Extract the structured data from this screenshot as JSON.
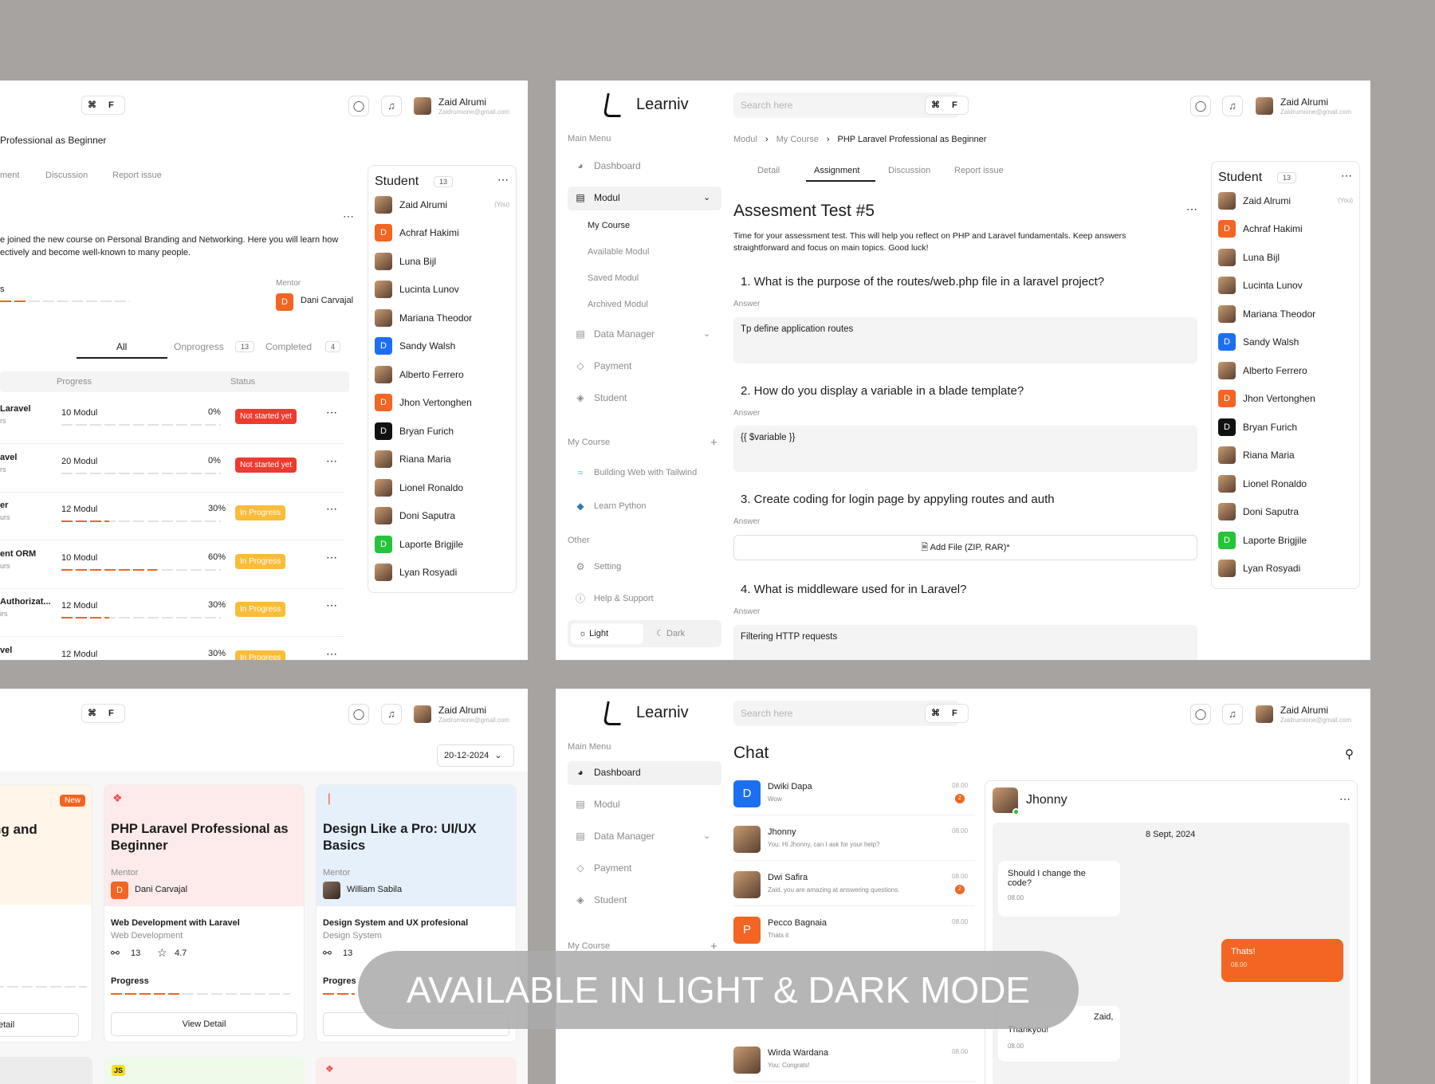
{
  "brand": {
    "name": "Learniv"
  },
  "search": {
    "placeholder": "Search here",
    "shortcut": "⌘ F"
  },
  "user": {
    "name": "Zaid Alrumi",
    "email": "Zaidrumione@gmail.com"
  },
  "students": {
    "title": "Student",
    "count": "13",
    "you_label": "(You)",
    "list": [
      {
        "name": "Zaid Alrumi",
        "avatar": "photo"
      },
      {
        "name": "Achraf Hakimi",
        "avatar": "D",
        "color": "#f26522"
      },
      {
        "name": "Luna Bijl",
        "avatar": "photo"
      },
      {
        "name": "Lucinta Lunov",
        "avatar": "photo"
      },
      {
        "name": "Mariana Theodor",
        "avatar": "photo"
      },
      {
        "name": "Sandy Walsh",
        "avatar": "D",
        "color": "#1d6ff2"
      },
      {
        "name": "Alberto Ferrero",
        "avatar": "photo"
      },
      {
        "name": "Jhon Vertonghen",
        "avatar": "D",
        "color": "#f26522"
      },
      {
        "name": "Bryan Furich",
        "avatar": "D",
        "color": "#111111"
      },
      {
        "name": "Riana Maria",
        "avatar": "photo"
      },
      {
        "name": "Lionel Ronaldo",
        "avatar": "photo"
      },
      {
        "name": "Doni Saputra",
        "avatar": "photo"
      },
      {
        "name": "Laporte Brigjile",
        "avatar": "D",
        "color": "#25c43a"
      },
      {
        "name": "Lyan Rosyadi",
        "avatar": "photo"
      }
    ]
  },
  "panel1": {
    "course_title": "Professional as Beginner",
    "tabs": [
      "ment",
      "Discussion",
      "Report issue"
    ],
    "intro": "e joined the new course on Personal Branding and Networking. Here you will learn how",
    "intro2": "ectively and become well-known to many people.",
    "stub": "s",
    "mentor_label": "Mentor",
    "mentor_name": "Dani Carvajal",
    "filters": {
      "all": "All",
      "onprogress": "Onprogress",
      "onprogress_count": "13",
      "completed": "Completed",
      "completed_count": "4"
    },
    "headers": {
      "progress": "Progress",
      "status": "Status"
    },
    "rows": [
      {
        "title": "Laravel",
        "sub": "rs",
        "modules": "10 Modul",
        "percent": "0%",
        "status": "Not started yet",
        "kind": "red",
        "fill": 0
      },
      {
        "title": "avel",
        "sub": "rs",
        "modules": "20 Modul",
        "percent": "0%",
        "status": "Not started yet",
        "kind": "red",
        "fill": 0
      },
      {
        "title": "er",
        "sub": "urs",
        "modules": "12 Modul",
        "percent": "30%",
        "status": "In Progress",
        "kind": "yellow",
        "fill": 0.3
      },
      {
        "title": "ent ORM",
        "sub": "urs",
        "modules": "10 Modul",
        "percent": "60%",
        "status": "In Progress",
        "kind": "yellow",
        "fill": 0.6
      },
      {
        "title": "Authorizat...",
        "sub": "irs",
        "modules": "12 Modul",
        "percent": "30%",
        "status": "In Progress",
        "kind": "yellow",
        "fill": 0.3
      },
      {
        "title": "vel",
        "sub": "",
        "modules": "12 Modul",
        "percent": "30%",
        "status": "In Progress",
        "kind": "yellow",
        "fill": 0.3
      }
    ]
  },
  "sidebar": {
    "main_menu": "Main Menu",
    "dashboard": "Dashboard",
    "modul": "Modul",
    "sub": [
      "My Course",
      "Available Modul",
      "Saved Modul",
      "Archived Modul"
    ],
    "data_manager": "Data Manager",
    "payment": "Payment",
    "student": "Student",
    "my_course": "My Course",
    "courses": [
      "Building Web with Tailwind",
      "Learn Python"
    ],
    "other": "Other",
    "setting": "Setting",
    "help": "Help & Support",
    "light": "Light",
    "dark": "Dark"
  },
  "panel2": {
    "breadcrumb": [
      "Modul",
      "My Course",
      "PHP Laravel Professional as Beginner"
    ],
    "tabs": [
      "Detail",
      "Assignment",
      "Discussion",
      "Report issue"
    ],
    "title": "Assesment Test #5",
    "desc1": "Time for your assessment test. This will help you reflect on PHP and Laravel fundamentals. Keep answers",
    "desc2": "straightforward and focus on main topics. Good luck!",
    "answer_label": "Answer",
    "questions": [
      {
        "q": "1. What is the purpose  of the routes/web.php file in a laravel project?",
        "a": "Tp define application routes"
      },
      {
        "q": "2. How do you display a variable in a blade template?",
        "a": "{{ $variable }}"
      },
      {
        "q": "3. Create coding for login page by appyling routes and auth",
        "a": "Add File (ZIP, RAR)*"
      },
      {
        "q": "4. What is middleware used for in Laravel?",
        "a": "Filtering HTTP requests"
      }
    ]
  },
  "panel3": {
    "date": "20-12-2024",
    "stub_title": "ng and",
    "new_badge": "New",
    "stub_btn": "etail",
    "cards": [
      {
        "title": "PHP Laravel Professional as Beginner",
        "mentor_label": "Mentor",
        "mentor": "Dani Carvajal",
        "course": "Web Development with Laravel",
        "category": "Web Development",
        "students": "13",
        "rating": "4.7",
        "progress_label": "Progress",
        "button": "View Detail"
      },
      {
        "title": "Design Like a Pro: UI/UX Basics",
        "mentor_label": "Mentor",
        "mentor": "William Sabila",
        "course": "Design System and UX profesional",
        "category": "Design System",
        "students": "13",
        "progress_label": "Progres"
      }
    ],
    "bottom_tag": "JS"
  },
  "panel4": {
    "title": "Chat",
    "chats": [
      {
        "name": "Dwiki Dapa",
        "msg": "Wow",
        "time": "08.00",
        "unread": "2",
        "avatar": "D",
        "color": "#1d6ff2"
      },
      {
        "name": "Jhonny",
        "msg": "You: Hi Jhonny, can I ask for your help?",
        "time": "08.00",
        "avatar": "photo"
      },
      {
        "name": "Dwi Safira",
        "msg": "Zaid, you are amazing at answering questions.",
        "time": "08.00",
        "unread": "2",
        "avatar": "photo"
      },
      {
        "name": "Pecco Bagnaia",
        "msg": "Thats it",
        "time": "08.00",
        "avatar": "P",
        "color": "#f26522"
      },
      {
        "name": "Wirda Wardana",
        "msg": "You: Congrats!",
        "time": "08.00",
        "avatar": "photo"
      }
    ],
    "convo": {
      "name": "Jhonny",
      "date": "8 Sept, 2024",
      "m1": "Should I change the code?",
      "m1_time": "08.00",
      "m2": "Thats!",
      "m2_time": "08.00",
      "m3a": "Zaid,",
      "m3": "Thankyou!",
      "m3_time": "08.00"
    }
  },
  "banner": {
    "text": "AVAILABLE IN LIGHT & DARK MODE"
  }
}
